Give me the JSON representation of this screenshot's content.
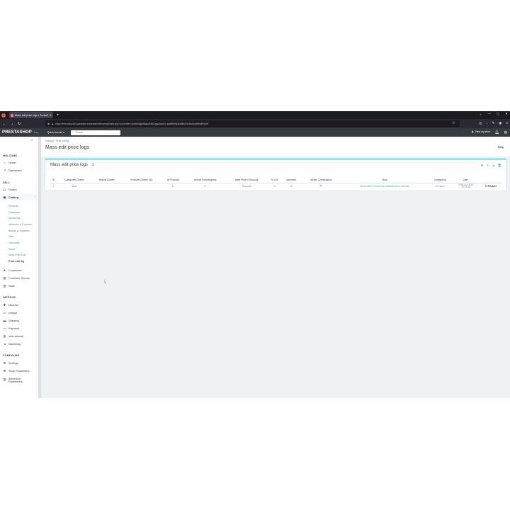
{
  "browser": {
    "tab_title": "Mass edit price logs • PrestaS...",
    "url": "https://microstock19.genevtor.com/adminfxhxmxy/index.php?controller=AdminAjaxMassEditLogs&token=ad4f8b0a3e4f8b2f3c94e4e8b5bf0f1a9f",
    "buttons": {
      "back": "←",
      "forward": "→",
      "reload": "↻",
      "new_tab": "+"
    },
    "window": {
      "minimize": "—",
      "maximize": "▢",
      "close": "✕"
    }
  },
  "header": {
    "logo": "PRESTASHOP",
    "version": "8.1.1",
    "quick_access": "Quick Access ▾",
    "search_placeholder": "Search",
    "view_store": "View my store"
  },
  "sidebar": {
    "sections": {
      "welcome": "WELCOME",
      "sell": "SELL",
      "improve": "IMPROVE",
      "configure": "CONFIGURE"
    },
    "items": {
      "home": "Home",
      "dashboard": "Dashboard",
      "orders": "Orders",
      "catalog": "Catalog",
      "customers": "Customers",
      "customer_service": "Customer Service",
      "stats": "Stats",
      "modules": "Modules",
      "design": "Design",
      "shipping": "Shipping",
      "payment": "Payment",
      "international": "International",
      "marketing": "Marketing",
      "settings": "Settings",
      "shop_parameters": "Shop Parameters",
      "advanced_parameters_1": "Advanced",
      "advanced_parameters_2": "Parameters"
    },
    "catalog_sub": [
      "Products",
      "Categories",
      "Monitoring",
      "Attributes & Features",
      "Brands & Suppliers",
      "Files",
      "Discounts",
      "Stock",
      "Mass Price Edit",
      "Price edit log"
    ]
  },
  "page": {
    "breadcrumb": "Catalog  ›  Price editing",
    "title": "Mass edit price logs",
    "help": "Help"
  },
  "panel": {
    "title": "Mass edit price logs",
    "count": "1",
    "columns": [
      "ID",
      "Categories Chosen",
      "Brands Chosen",
      "Products Chosen (ID)",
      "All Products",
      "Include Subcategories",
      "Base Price or Discount",
      "% or $",
      "Increment",
      "Include Combinations",
      "Shop",
      "Changed by",
      "Date",
      ""
    ],
    "rows": [
      {
        "id": "1",
        "categories": "Boot",
        "brands": "",
        "products": "",
        "all_products": "1?",
        "include_subcategories": "✓",
        "base_price_or_discount": "Discount",
        "percent_or_dollar": "%",
        "increment": "10",
        "include_combinations": "✕",
        "shop": "Ultramodern PrestaShop Modules Demo Website",
        "changed_by": "D. Demo",
        "date_line1": "2024-04-19 03",
        "date_line2": "12:15:26",
        "action": "↻ Restore"
      }
    ]
  }
}
